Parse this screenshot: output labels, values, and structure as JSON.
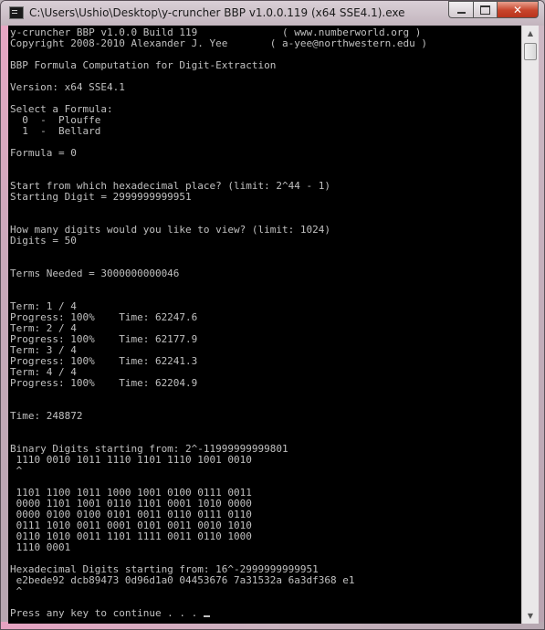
{
  "window": {
    "title": "C:\\Users\\Ushio\\Desktop\\y-cruncher BBP v1.0.0.119 (x64 SSE4.1).exe",
    "close_glyph": "✕"
  },
  "scrollbar": {
    "up_glyph": "▲",
    "down_glyph": "▼"
  },
  "console": {
    "lines": [
      "y-cruncher BBP v1.0.0 Build 119              ( www.numberworld.org )",
      "Copyright 2008-2010 Alexander J. Yee       ( a-yee@northwestern.edu )",
      "",
      "BBP Formula Computation for Digit-Extraction",
      "",
      "Version: x64 SSE4.1",
      "",
      "Select a Formula:",
      "  0  -  Plouffe",
      "  1  -  Bellard",
      "",
      "Formula = 0",
      "",
      "",
      "Start from which hexadecimal place? (limit: 2^44 - 1)",
      "Starting Digit = 2999999999951",
      "",
      "",
      "How many digits would you like to view? (limit: 1024)",
      "Digits = 50",
      "",
      "",
      "Terms Needed = 3000000000046",
      "",
      "",
      "Term: 1 / 4",
      "Progress: 100%    Time: 62247.6",
      "Term: 2 / 4",
      "Progress: 100%    Time: 62177.9",
      "Term: 3 / 4",
      "Progress: 100%    Time: 62241.3",
      "Term: 4 / 4",
      "Progress: 100%    Time: 62204.9",
      "",
      "",
      "Time: 248872",
      "",
      "",
      "Binary Digits starting from: 2^-11999999999801",
      " 1110 0010 1011 1110 1101 1110 1001 0010",
      " ^",
      "",
      " 1101 1100 1011 1000 1001 0100 0111 0011",
      " 0000 1101 1001 0110 1101 0001 1010 0000",
      " 0000 0100 0100 0101 0011 0110 0111 0110",
      " 0111 1010 0011 0001 0101 0011 0010 1010",
      " 0110 1010 0011 1101 1111 0011 0110 1000",
      " 1110 0001",
      "",
      "Hexadecimal Digits starting from: 16^-2999999999951",
      " e2bede92 dcb89473 0d96d1a0 04453676 7a31532a 6a3df368 e1",
      " ^",
      "",
      "Press any key to continue . . . "
    ]
  }
}
